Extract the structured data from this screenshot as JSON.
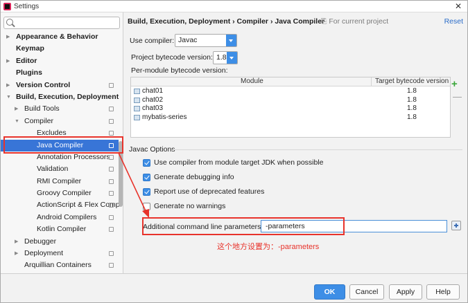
{
  "window": {
    "title": "Settings",
    "close_glyph": "✕"
  },
  "sidebar": {
    "search_placeholder": "",
    "items": [
      {
        "label": "Appearance & Behavior",
        "bold": true,
        "arrow": "▶",
        "indent": 0,
        "project": false
      },
      {
        "label": "Keymap",
        "bold": true,
        "arrow": "",
        "indent": 0,
        "project": false
      },
      {
        "label": "Editor",
        "bold": true,
        "arrow": "▶",
        "indent": 0,
        "project": false
      },
      {
        "label": "Plugins",
        "bold": true,
        "arrow": "",
        "indent": 0,
        "project": false
      },
      {
        "label": "Version Control",
        "bold": true,
        "arrow": "▶",
        "indent": 0,
        "project": true
      },
      {
        "label": "Build, Execution, Deployment",
        "bold": true,
        "arrow": "▼",
        "indent": 0,
        "project": false
      },
      {
        "label": "Build Tools",
        "bold": false,
        "arrow": "▶",
        "indent": 1,
        "project": true
      },
      {
        "label": "Compiler",
        "bold": false,
        "arrow": "▼",
        "indent": 1,
        "project": true
      },
      {
        "label": "Excludes",
        "bold": false,
        "arrow": "",
        "indent": 2,
        "project": true
      },
      {
        "label": "Java Compiler",
        "bold": false,
        "arrow": "",
        "indent": 2,
        "project": true,
        "selected": true
      },
      {
        "label": "Annotation Processors",
        "bold": false,
        "arrow": "",
        "indent": 2,
        "project": true
      },
      {
        "label": "Validation",
        "bold": false,
        "arrow": "",
        "indent": 2,
        "project": true
      },
      {
        "label": "RMI Compiler",
        "bold": false,
        "arrow": "",
        "indent": 2,
        "project": true
      },
      {
        "label": "Groovy Compiler",
        "bold": false,
        "arrow": "",
        "indent": 2,
        "project": true
      },
      {
        "label": "ActionScript & Flex Comp",
        "bold": false,
        "arrow": "",
        "indent": 2,
        "project": true
      },
      {
        "label": "Android Compilers",
        "bold": false,
        "arrow": "",
        "indent": 2,
        "project": true
      },
      {
        "label": "Kotlin Compiler",
        "bold": false,
        "arrow": "",
        "indent": 2,
        "project": true
      },
      {
        "label": "Debugger",
        "bold": false,
        "arrow": "▶",
        "indent": 1,
        "project": false
      },
      {
        "label": "Deployment",
        "bold": false,
        "arrow": "▶",
        "indent": 1,
        "project": true
      },
      {
        "label": "Arquillian Containers",
        "bold": false,
        "arrow": "",
        "indent": 1,
        "project": true
      }
    ]
  },
  "main": {
    "breadcrumb": "Build, Execution, Deployment › Compiler › Java Compiler",
    "scope_icon": "⎘",
    "scope_label": "For current project",
    "reset_label": "Reset",
    "use_compiler_label": "Use compiler:",
    "use_compiler_value": "Javac",
    "bytecode_label": "Project bytecode version:",
    "bytecode_value": "1.8",
    "per_module_label": "Per-module bytecode version:",
    "table": {
      "headers": [
        "Module",
        "Target bytecode version"
      ],
      "rows": [
        {
          "module": "chat01",
          "version": "1.8"
        },
        {
          "module": "chat02",
          "version": "1.8"
        },
        {
          "module": "chat03",
          "version": "1.8"
        },
        {
          "module": "mybatis-series",
          "version": "1.8"
        }
      ]
    },
    "plus_glyph": "+",
    "minus_glyph": "—",
    "javac_options_title": "Javac Options",
    "options": [
      {
        "label": "Use compiler from module target JDK when possible",
        "checked": true
      },
      {
        "label": "Generate debugging info",
        "checked": true
      },
      {
        "label": "Report use of deprecated features",
        "checked": true
      },
      {
        "label": "Generate no warnings",
        "checked": false
      }
    ],
    "params_label": "Additional command line parameters:",
    "params_value": "-parameters",
    "annotation_note": "这个地方设置为：-parameters"
  },
  "footer": {
    "ok_label": "OK",
    "cancel_label": "Cancel",
    "apply_label": "Apply",
    "help_label": "Help"
  },
  "colors": {
    "accent": "#3d8ee6",
    "selection": "#3875d7",
    "annotation_red": "#e8332b",
    "link": "#2a6cc9"
  }
}
